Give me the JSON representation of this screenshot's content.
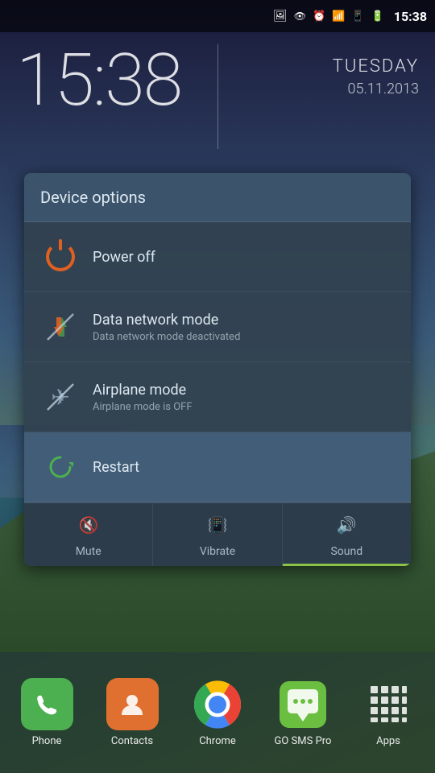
{
  "statusBar": {
    "time": "15:38",
    "icons": [
      "photo",
      "eye",
      "alarm",
      "wifi",
      "signal",
      "battery"
    ]
  },
  "clock": {
    "time": "15:38",
    "day": "TUESDAY",
    "date": "05.11.2013"
  },
  "dialog": {
    "title": "Device options",
    "items": [
      {
        "id": "power-off",
        "title": "Power off",
        "subtitle": "",
        "icon": "power"
      },
      {
        "id": "data-network",
        "title": "Data network mode",
        "subtitle": "Data network mode deactivated",
        "icon": "network"
      },
      {
        "id": "airplane-mode",
        "title": "Airplane mode",
        "subtitle": "Airplane mode is OFF",
        "icon": "airplane"
      },
      {
        "id": "restart",
        "title": "Restart",
        "subtitle": "",
        "icon": "restart"
      }
    ],
    "soundOptions": [
      {
        "id": "mute",
        "label": "Mute",
        "active": false
      },
      {
        "id": "vibrate",
        "label": "Vibrate",
        "active": false
      },
      {
        "id": "sound",
        "label": "Sound",
        "active": true
      }
    ]
  },
  "dock": {
    "items": [
      {
        "id": "phone",
        "label": "Phone",
        "icon": "phone"
      },
      {
        "id": "contacts",
        "label": "Contacts",
        "icon": "contacts"
      },
      {
        "id": "chrome",
        "label": "Chrome",
        "icon": "chrome"
      },
      {
        "id": "gosms",
        "label": "GO SMS Pro",
        "icon": "gosms"
      },
      {
        "id": "apps",
        "label": "Apps",
        "icon": "apps"
      }
    ]
  }
}
